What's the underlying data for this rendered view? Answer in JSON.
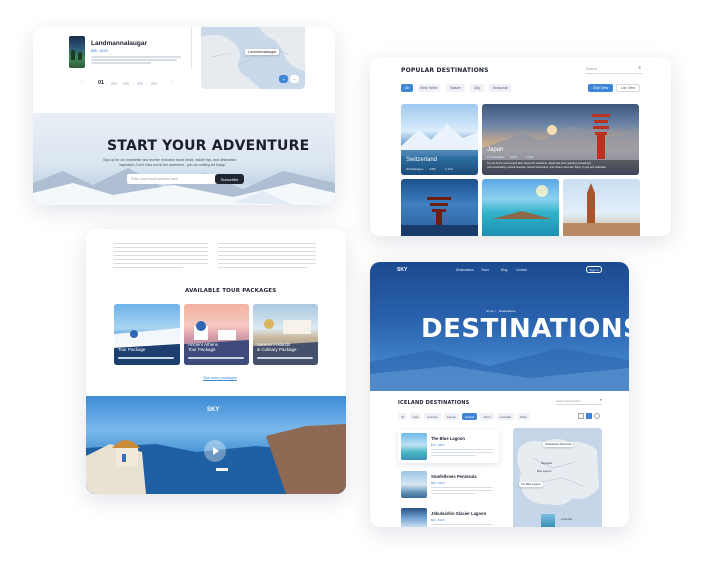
{
  "colors": {
    "accent": "#3f86d6",
    "dark_btn": "#1f2633",
    "hero_blue": "#1f4f9a"
  },
  "adventure": {
    "card_title": "Landmannalaugar",
    "card_price": "$85 - $200",
    "page_current": "01",
    "map_label": "Landmannalaugar",
    "heading": "START YOUR ADVENTURE",
    "sub1": "Sign up for our newsletter and receive exclusive travel deals, insider tips, and destination",
    "sub2": "inspiration. Don't miss out on the adventure - join our mailing list today!",
    "email_placeholder": "Enter your email address here",
    "subscribe_label": "Subscribe"
  },
  "popular": {
    "title": "POPULAR DESTINATIONS",
    "search_placeholder": "Search",
    "filters": [
      "All",
      "Best Seller",
      "Nature",
      "City",
      "Seasonal"
    ],
    "grid_label": "Grid View",
    "list_label": "List View",
    "cards": [
      {
        "name": "Switzerland",
        "meta1": "20 Packages",
        "meta2": "4.8/5",
        "meta3": "1,124"
      },
      {
        "name": "Japan",
        "meta1": "12 Packages",
        "meta2": "4.9/5",
        "meta3": "1,543"
      }
    ],
    "japan_desc1": "As one of the most sought-after places for vacations, Japan has been growing exceedingly",
    "japan_desc2": "with breathtaking natural beauties, historic landmarks, and vibrant cities like Tokyo, Kyoto and Hokkaido."
  },
  "packages": {
    "title": "AVAILABLE TOUR PACKAGES",
    "items": [
      {
        "name": "Discover Greece\nTour Package"
      },
      {
        "name": "Ancient Athens\nTour Package"
      },
      {
        "name": "Santorini Islands\n& Culinary Package"
      }
    ],
    "more_label": "See more packages",
    "logo": "SKY"
  },
  "destinations": {
    "logo": "SKY",
    "nav": [
      "Destinations",
      "Tours",
      "Blog",
      "Contact"
    ],
    "signin_label": "Sign In",
    "breadcrumb_home": "Home",
    "breadcrumb_current": "Destinations",
    "hero_title": "DESTINATIONS",
    "list_title": "ICELAND DESTINATIONS",
    "search_placeholder": "Search destination",
    "filters": [
      "All",
      "Asia",
      "America",
      "Europe",
      "Iceland",
      "Africa",
      "Australia",
      "Other"
    ],
    "items": [
      {
        "name": "The Blue Lagoon",
        "price": "$75 - $200"
      },
      {
        "name": "Snæfellsnes Peninsula",
        "price": "$60 - $150"
      },
      {
        "name": "Jökulsárlón Glacier Lagoon",
        "price": "$60 - $200"
      }
    ],
    "map_labels": [
      "Snæfellsnes Peninsula",
      "Reykjavik",
      "Blue Lagoon",
      "The Blue Lagoon",
      "Þórsmörk"
    ]
  }
}
